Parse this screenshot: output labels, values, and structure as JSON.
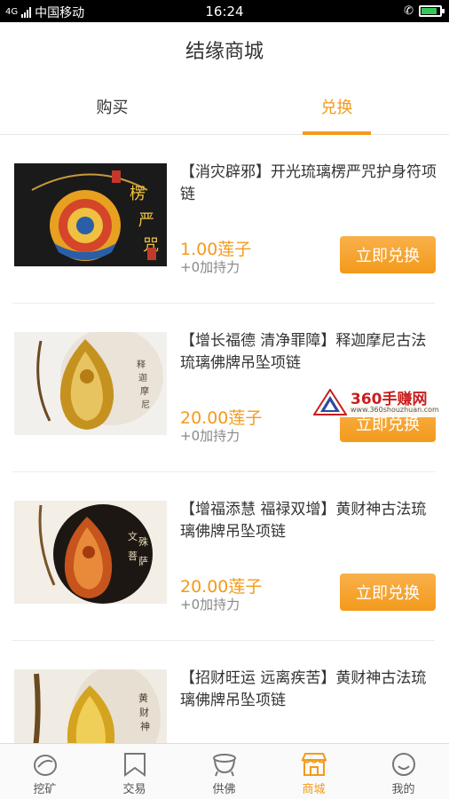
{
  "status_bar": {
    "network": "4G",
    "carrier": "中国移动",
    "time": "16:24",
    "battery_level": 0.85
  },
  "header": {
    "title": "结缘商城"
  },
  "tabs": [
    {
      "label": "购买",
      "active": false
    },
    {
      "label": "兑换",
      "active": true
    }
  ],
  "products": [
    {
      "name": "【消灾辟邪】开光琉璃楞严咒护身符项链",
      "price": "1.00莲子",
      "bonus": "+0加持力",
      "button": "立即兑换",
      "image": "pendant-shurangama"
    },
    {
      "name": "【增长福德 清净罪障】释迦摩尼古法琉璃佛牌吊坠项链",
      "price": "20.00莲子",
      "bonus": "+0加持力",
      "button": "立即兑换",
      "image": "pendant-shakyamuni"
    },
    {
      "name": "【增福添慧 福禄双增】黄财神古法琉璃佛牌吊坠项链",
      "price": "20.00莲子",
      "bonus": "+0加持力",
      "button": "立即兑换",
      "image": "pendant-manjushri"
    },
    {
      "name": "【招财旺运 远离疾苦】黄财神古法琉璃佛牌吊坠项链",
      "price": "",
      "bonus": "",
      "button": "",
      "image": "pendant-jambhala"
    }
  ],
  "watermark": {
    "name": "360手赚网",
    "url": "www.360shouzhuan.com"
  },
  "bottom_nav": [
    {
      "label": "挖矿",
      "icon": "mining-icon",
      "active": false
    },
    {
      "label": "交易",
      "icon": "bookmark-icon",
      "active": false
    },
    {
      "label": "供佛",
      "icon": "incense-burner-icon",
      "active": false
    },
    {
      "label": "商城",
      "icon": "shop-icon",
      "active": true
    },
    {
      "label": "我的",
      "icon": "smiley-icon",
      "active": false
    }
  ],
  "colors": {
    "accent": "#f39a1b",
    "text": "#333333",
    "muted": "#888888"
  }
}
